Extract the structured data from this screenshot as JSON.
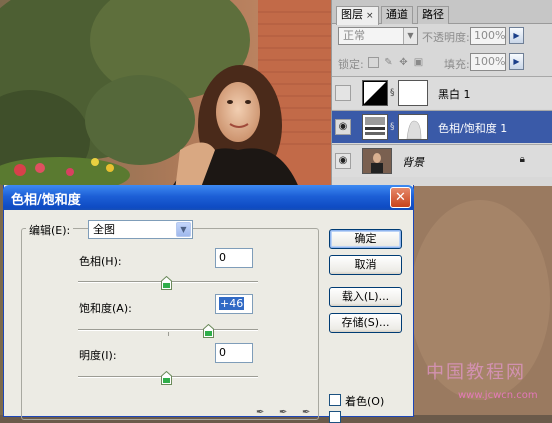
{
  "layers_panel": {
    "tabs": [
      {
        "label": "图层",
        "active": true,
        "close": "×"
      },
      {
        "label": "通道",
        "active": false
      },
      {
        "label": "路径",
        "active": false
      }
    ],
    "blend_mode": "正常",
    "opacity_label": "不透明度:",
    "opacity_value": "100%",
    "lock_label": "锁定:",
    "fill_label": "填充:",
    "fill_value": "100%",
    "layers": [
      {
        "name": "黑白 1",
        "visible": false,
        "selected": false,
        "thumb": "black-white-adjustment"
      },
      {
        "name": "色相/饱和度 1",
        "visible": true,
        "selected": true,
        "thumb": "hue-saturation-adjustment"
      },
      {
        "name": "背景",
        "visible": true,
        "selected": false,
        "locked": true,
        "thumb": "photo"
      }
    ]
  },
  "dialog": {
    "title": "色相/饱和度",
    "edit_label": "编辑(E):",
    "edit_value": "全图",
    "hue_label": "色相(H):",
    "hue_value": "0",
    "saturation_label": "饱和度(A):",
    "saturation_value": "+46",
    "lightness_label": "明度(I):",
    "lightness_value": "0",
    "buttons": {
      "ok": "确定",
      "cancel": "取消",
      "load": "载入(L)...",
      "save": "存储(S)..."
    },
    "colorize_label": "着色(O)",
    "colorize_checked": false
  },
  "watermark": {
    "text": "中国教程网",
    "url": "www.jcwcn.com"
  },
  "colors": {
    "titlebar": "#1d5fd6",
    "selected_layer": "#3a5aa8",
    "dialog_bg": "#ecebe4"
  }
}
